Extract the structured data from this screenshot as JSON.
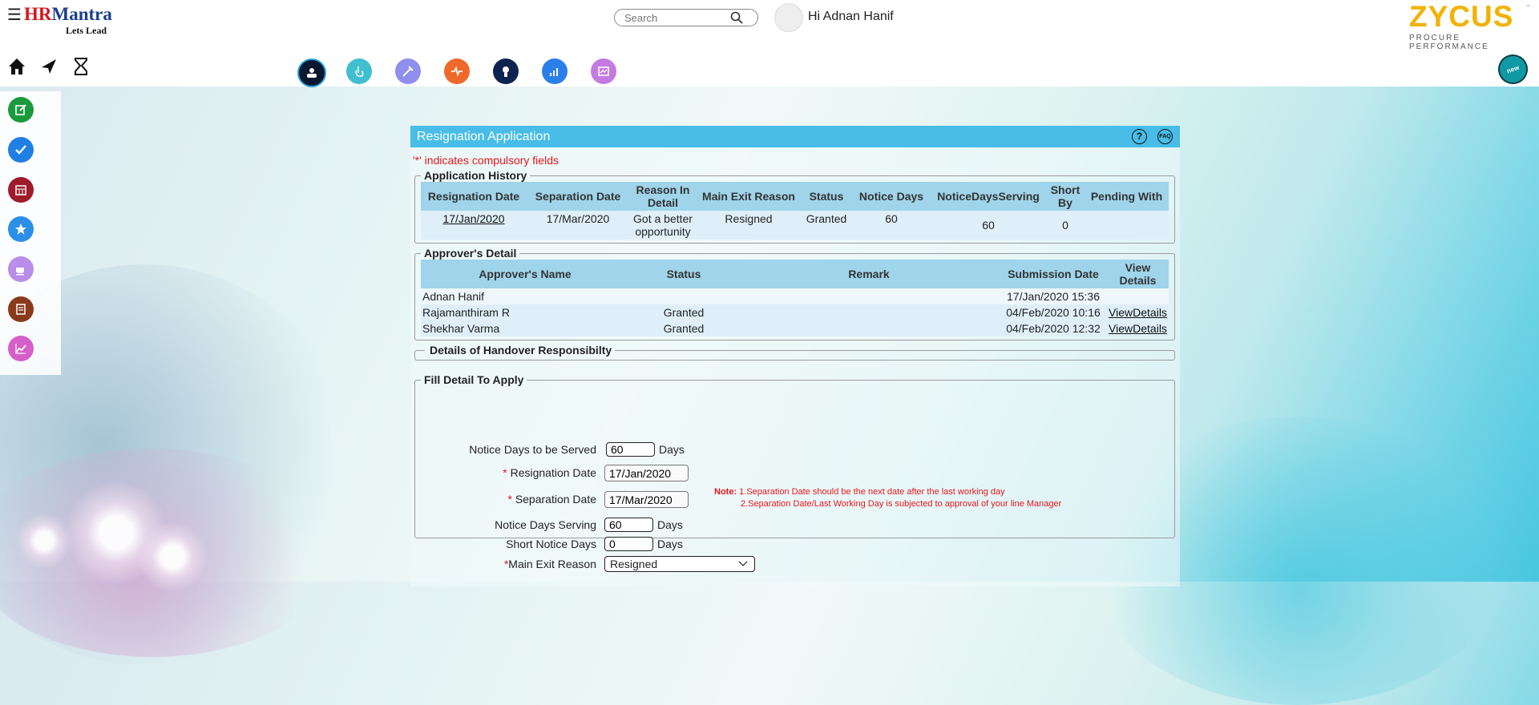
{
  "header": {
    "logo_hr": "HR",
    "logo_mantra": "Mantra",
    "tagline": "Lets Lead",
    "search_placeholder": "Search",
    "greeting": "Hi Adnan Hanif",
    "brand": "ZYCUS",
    "brand_tagline": "PROCURE PERFORMANCE",
    "tm": "™",
    "new_badge": "new"
  },
  "panel": {
    "title": "Resignation Application",
    "help_icon": "?",
    "faq_icon": "FAQ",
    "compulsory_note": "'*' indicates compulsory fields"
  },
  "application_history": {
    "legend": "Application History",
    "columns": [
      "Resignation Date",
      "Separation Date",
      "Reason In Detail",
      "Main Exit Reason",
      "Status",
      "Notice Days",
      "NoticeDaysServing",
      "Short By",
      "Pending With"
    ],
    "row": {
      "resignation_date": "17/Jan/2020",
      "separation_date": "17/Mar/2020",
      "reason_in_detail": "Got a better opportunity",
      "main_exit_reason": "Resigned",
      "status": "Granted",
      "notice_days": "60",
      "notice_days_serving": "60",
      "short_by": "0",
      "pending_with": ""
    }
  },
  "approvers": {
    "legend": "Approver's Detail",
    "columns": [
      "Approver's Name",
      "Status",
      "Remark",
      "Submission Date",
      "View Details"
    ],
    "rows": [
      {
        "name": "Adnan Hanif",
        "status": "",
        "remark": "",
        "submission": "17/Jan/2020 15:36",
        "view": ""
      },
      {
        "name": "Rajamanthiram R",
        "status": "Granted",
        "remark": "",
        "submission": "04/Feb/2020 10:16",
        "view": "ViewDetails"
      },
      {
        "name": "Shekhar Varma",
        "status": "Granted",
        "remark": "",
        "submission": "04/Feb/2020 12:32",
        "view": "ViewDetails"
      }
    ]
  },
  "handover": {
    "legend": "Details of Handover Responsibilty"
  },
  "fill_detail": {
    "legend": "Fill Detail To Apply",
    "notice_days_label": "Notice Days to be Served",
    "notice_days_value": "60",
    "days_unit": "Days",
    "resignation_date_label": "Resignation Date",
    "resignation_date_value": "17/Jan/2020",
    "separation_date_label": "Separation Date",
    "separation_date_value": "17/Mar/2020",
    "notice_serving_label": "Notice Days Serving",
    "notice_serving_value": "60",
    "short_notice_label": "Short Notice Days",
    "short_notice_value": "0",
    "main_exit_label": "Main Exit Reason",
    "main_exit_value": "Resigned",
    "required_marker": "*",
    "note_label": "Note:",
    "note_1": "1.Separation Date should be the next date after the last working day",
    "note_2": "2.Separation Date/Last Working Day is subjected to approval of your line Manager"
  },
  "colors": {
    "panel_header": "#47bde7",
    "table_header": "#9fd4ea",
    "required": "#e8151c",
    "brand": "#f2b200"
  }
}
